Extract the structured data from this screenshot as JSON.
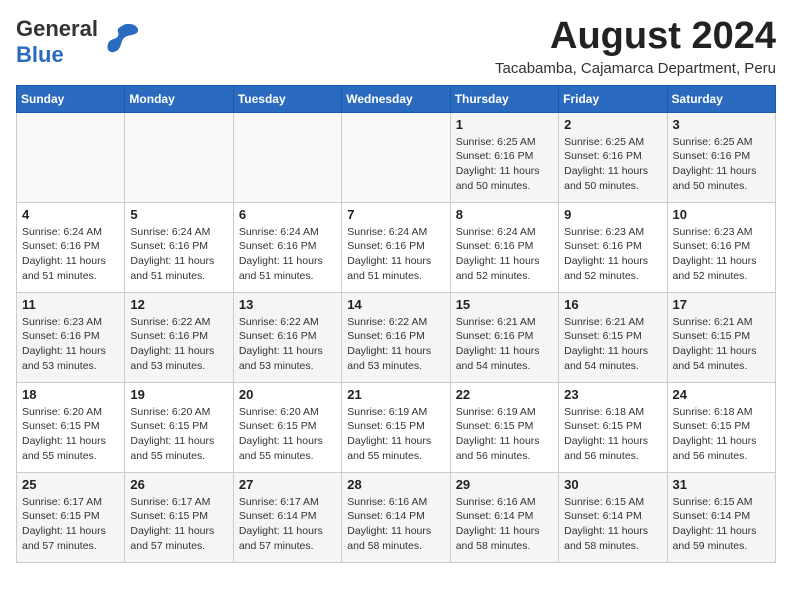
{
  "header": {
    "logo_general": "General",
    "logo_blue": "Blue",
    "month_year": "August 2024",
    "location": "Tacabamba, Cajamarca Department, Peru"
  },
  "weekdays": [
    "Sunday",
    "Monday",
    "Tuesday",
    "Wednesday",
    "Thursday",
    "Friday",
    "Saturday"
  ],
  "weeks": [
    [
      {
        "day": "",
        "sunrise": "",
        "sunset": "",
        "daylight": ""
      },
      {
        "day": "",
        "sunrise": "",
        "sunset": "",
        "daylight": ""
      },
      {
        "day": "",
        "sunrise": "",
        "sunset": "",
        "daylight": ""
      },
      {
        "day": "",
        "sunrise": "",
        "sunset": "",
        "daylight": ""
      },
      {
        "day": "1",
        "sunrise": "Sunrise: 6:25 AM",
        "sunset": "Sunset: 6:16 PM",
        "daylight": "Daylight: 11 hours and 50 minutes."
      },
      {
        "day": "2",
        "sunrise": "Sunrise: 6:25 AM",
        "sunset": "Sunset: 6:16 PM",
        "daylight": "Daylight: 11 hours and 50 minutes."
      },
      {
        "day": "3",
        "sunrise": "Sunrise: 6:25 AM",
        "sunset": "Sunset: 6:16 PM",
        "daylight": "Daylight: 11 hours and 50 minutes."
      }
    ],
    [
      {
        "day": "4",
        "sunrise": "Sunrise: 6:24 AM",
        "sunset": "Sunset: 6:16 PM",
        "daylight": "Daylight: 11 hours and 51 minutes."
      },
      {
        "day": "5",
        "sunrise": "Sunrise: 6:24 AM",
        "sunset": "Sunset: 6:16 PM",
        "daylight": "Daylight: 11 hours and 51 minutes."
      },
      {
        "day": "6",
        "sunrise": "Sunrise: 6:24 AM",
        "sunset": "Sunset: 6:16 PM",
        "daylight": "Daylight: 11 hours and 51 minutes."
      },
      {
        "day": "7",
        "sunrise": "Sunrise: 6:24 AM",
        "sunset": "Sunset: 6:16 PM",
        "daylight": "Daylight: 11 hours and 51 minutes."
      },
      {
        "day": "8",
        "sunrise": "Sunrise: 6:24 AM",
        "sunset": "Sunset: 6:16 PM",
        "daylight": "Daylight: 11 hours and 52 minutes."
      },
      {
        "day": "9",
        "sunrise": "Sunrise: 6:23 AM",
        "sunset": "Sunset: 6:16 PM",
        "daylight": "Daylight: 11 hours and 52 minutes."
      },
      {
        "day": "10",
        "sunrise": "Sunrise: 6:23 AM",
        "sunset": "Sunset: 6:16 PM",
        "daylight": "Daylight: 11 hours and 52 minutes."
      }
    ],
    [
      {
        "day": "11",
        "sunrise": "Sunrise: 6:23 AM",
        "sunset": "Sunset: 6:16 PM",
        "daylight": "Daylight: 11 hours and 53 minutes."
      },
      {
        "day": "12",
        "sunrise": "Sunrise: 6:22 AM",
        "sunset": "Sunset: 6:16 PM",
        "daylight": "Daylight: 11 hours and 53 minutes."
      },
      {
        "day": "13",
        "sunrise": "Sunrise: 6:22 AM",
        "sunset": "Sunset: 6:16 PM",
        "daylight": "Daylight: 11 hours and 53 minutes."
      },
      {
        "day": "14",
        "sunrise": "Sunrise: 6:22 AM",
        "sunset": "Sunset: 6:16 PM",
        "daylight": "Daylight: 11 hours and 53 minutes."
      },
      {
        "day": "15",
        "sunrise": "Sunrise: 6:21 AM",
        "sunset": "Sunset: 6:16 PM",
        "daylight": "Daylight: 11 hours and 54 minutes."
      },
      {
        "day": "16",
        "sunrise": "Sunrise: 6:21 AM",
        "sunset": "Sunset: 6:15 PM",
        "daylight": "Daylight: 11 hours and 54 minutes."
      },
      {
        "day": "17",
        "sunrise": "Sunrise: 6:21 AM",
        "sunset": "Sunset: 6:15 PM",
        "daylight": "Daylight: 11 hours and 54 minutes."
      }
    ],
    [
      {
        "day": "18",
        "sunrise": "Sunrise: 6:20 AM",
        "sunset": "Sunset: 6:15 PM",
        "daylight": "Daylight: 11 hours and 55 minutes."
      },
      {
        "day": "19",
        "sunrise": "Sunrise: 6:20 AM",
        "sunset": "Sunset: 6:15 PM",
        "daylight": "Daylight: 11 hours and 55 minutes."
      },
      {
        "day": "20",
        "sunrise": "Sunrise: 6:20 AM",
        "sunset": "Sunset: 6:15 PM",
        "daylight": "Daylight: 11 hours and 55 minutes."
      },
      {
        "day": "21",
        "sunrise": "Sunrise: 6:19 AM",
        "sunset": "Sunset: 6:15 PM",
        "daylight": "Daylight: 11 hours and 55 minutes."
      },
      {
        "day": "22",
        "sunrise": "Sunrise: 6:19 AM",
        "sunset": "Sunset: 6:15 PM",
        "daylight": "Daylight: 11 hours and 56 minutes."
      },
      {
        "day": "23",
        "sunrise": "Sunrise: 6:18 AM",
        "sunset": "Sunset: 6:15 PM",
        "daylight": "Daylight: 11 hours and 56 minutes."
      },
      {
        "day": "24",
        "sunrise": "Sunrise: 6:18 AM",
        "sunset": "Sunset: 6:15 PM",
        "daylight": "Daylight: 11 hours and 56 minutes."
      }
    ],
    [
      {
        "day": "25",
        "sunrise": "Sunrise: 6:17 AM",
        "sunset": "Sunset: 6:15 PM",
        "daylight": "Daylight: 11 hours and 57 minutes."
      },
      {
        "day": "26",
        "sunrise": "Sunrise: 6:17 AM",
        "sunset": "Sunset: 6:15 PM",
        "daylight": "Daylight: 11 hours and 57 minutes."
      },
      {
        "day": "27",
        "sunrise": "Sunrise: 6:17 AM",
        "sunset": "Sunset: 6:14 PM",
        "daylight": "Daylight: 11 hours and 57 minutes."
      },
      {
        "day": "28",
        "sunrise": "Sunrise: 6:16 AM",
        "sunset": "Sunset: 6:14 PM",
        "daylight": "Daylight: 11 hours and 58 minutes."
      },
      {
        "day": "29",
        "sunrise": "Sunrise: 6:16 AM",
        "sunset": "Sunset: 6:14 PM",
        "daylight": "Daylight: 11 hours and 58 minutes."
      },
      {
        "day": "30",
        "sunrise": "Sunrise: 6:15 AM",
        "sunset": "Sunset: 6:14 PM",
        "daylight": "Daylight: 11 hours and 58 minutes."
      },
      {
        "day": "31",
        "sunrise": "Sunrise: 6:15 AM",
        "sunset": "Sunset: 6:14 PM",
        "daylight": "Daylight: 11 hours and 59 minutes."
      }
    ]
  ]
}
